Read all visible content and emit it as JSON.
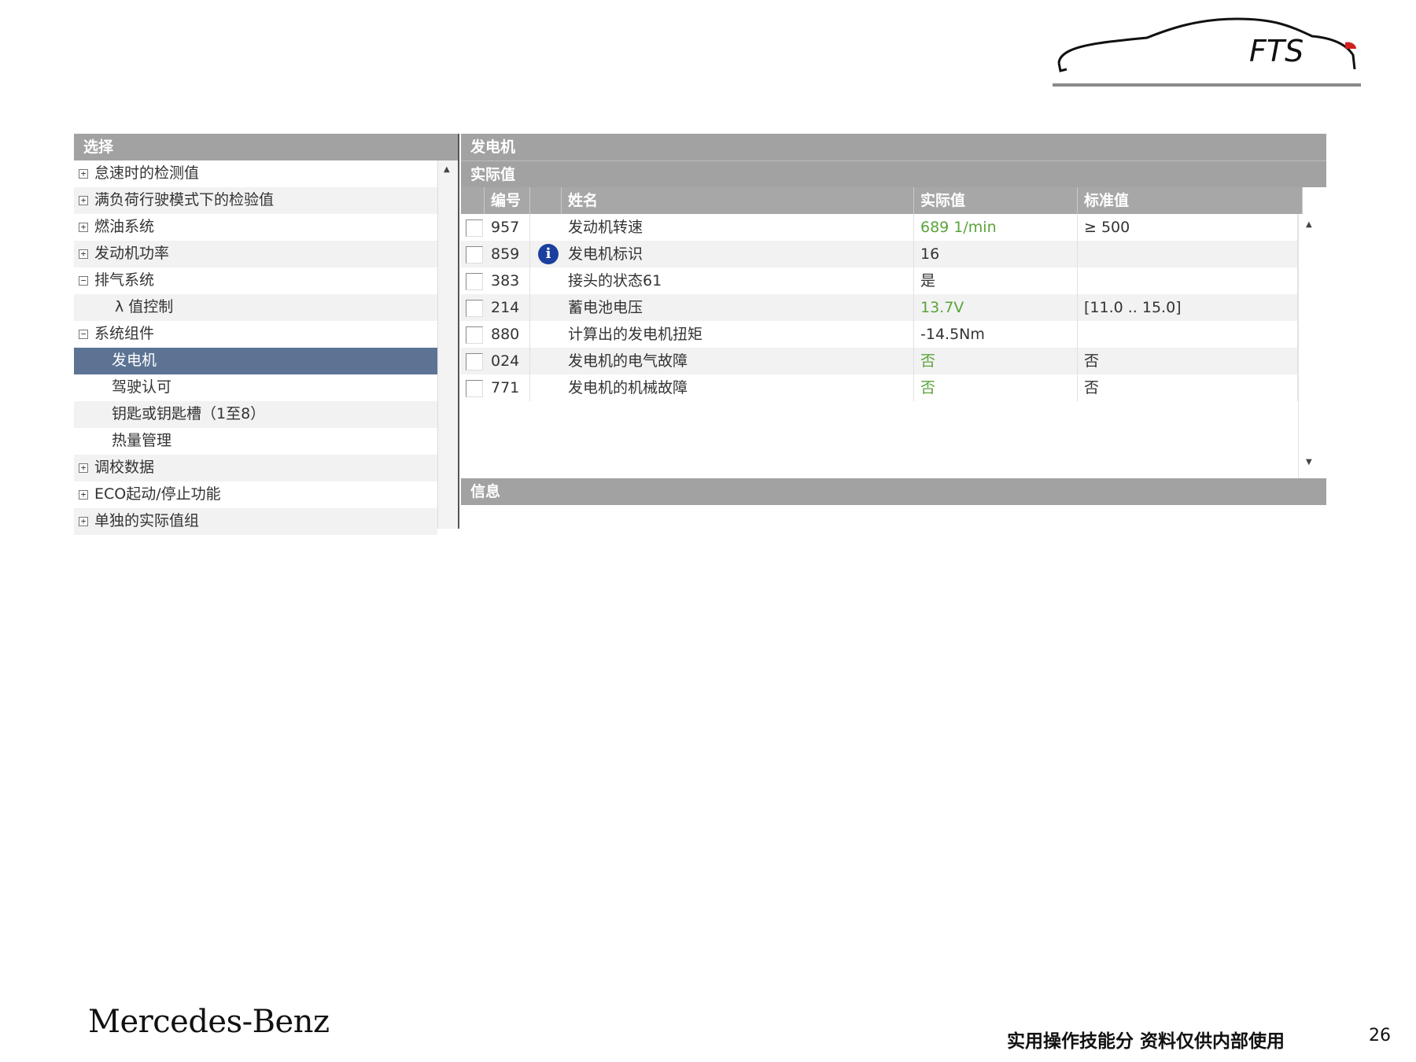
{
  "logo": {
    "text": "FTS"
  },
  "left_panel": {
    "header": "选择",
    "items": [
      {
        "label": "怠速时的检测值",
        "expander": "+",
        "indent": 0,
        "selected": false
      },
      {
        "label": "满负荷行驶模式下的检验值",
        "expander": "+",
        "indent": 0,
        "selected": false
      },
      {
        "label": "燃油系统",
        "expander": "+",
        "indent": 0,
        "selected": false
      },
      {
        "label": "发动机功率",
        "expander": "+",
        "indent": 0,
        "selected": false
      },
      {
        "label": "排气系统",
        "expander": "−",
        "indent": 0,
        "selected": false
      },
      {
        "label": "λ 值控制",
        "expander": "",
        "indent": 2,
        "selected": false
      },
      {
        "label": "系统组件",
        "expander": "−",
        "indent": 0,
        "selected": false
      },
      {
        "label": "发电机",
        "expander": "",
        "indent": 1,
        "selected": true
      },
      {
        "label": "驾驶认可",
        "expander": "",
        "indent": 1,
        "selected": false
      },
      {
        "label": "钥匙或钥匙槽（1至8）",
        "expander": "",
        "indent": 1,
        "selected": false
      },
      {
        "label": "热量管理",
        "expander": "",
        "indent": 1,
        "selected": false
      },
      {
        "label": "调校数据",
        "expander": "+",
        "indent": 0,
        "selected": false
      },
      {
        "label": "ECO起动/停止功能",
        "expander": "+",
        "indent": 0,
        "selected": false
      },
      {
        "label": "单独的实际值组",
        "expander": "+",
        "indent": 0,
        "selected": false
      }
    ]
  },
  "right_panel": {
    "title": "发电机",
    "subtitle": "实际值",
    "columns": {
      "id": "编号",
      "name": "姓名",
      "actual": "实际值",
      "standard": "标准值"
    },
    "rows": [
      {
        "id": "957",
        "info": false,
        "name": "发动机转速",
        "actual": "689 1/min",
        "actual_green": true,
        "standard": "≥ 500"
      },
      {
        "id": "859",
        "info": true,
        "name": "发电机标识",
        "actual": "16",
        "actual_green": false,
        "standard": ""
      },
      {
        "id": "383",
        "info": false,
        "name": "接头的状态61",
        "actual": "是",
        "actual_green": false,
        "standard": ""
      },
      {
        "id": "214",
        "info": false,
        "name": "蓄电池电压",
        "actual": "13.7V",
        "actual_green": true,
        "standard": "[11.0 .. 15.0]"
      },
      {
        "id": "880",
        "info": false,
        "name": "计算出的发电机扭矩",
        "actual": "-14.5Nm",
        "actual_green": false,
        "standard": ""
      },
      {
        "id": "024",
        "info": false,
        "name": "发电机的电气故障",
        "actual": "否",
        "actual_green": true,
        "standard": "否"
      },
      {
        "id": "771",
        "info": false,
        "name": "发电机的机械故障",
        "actual": "否",
        "actual_green": true,
        "standard": "否"
      }
    ],
    "info_header": "信息"
  },
  "footer": {
    "brand": "Mercedes-Benz",
    "note": "实用操作技能分 资料仅供内部使用",
    "page": "26"
  },
  "colors": {
    "header_gray": "#a2a2a2",
    "selection_blue": "#5c7394",
    "value_green": "#5aa43a",
    "info_blue": "#1a3f9e"
  },
  "icons": {
    "info": "info-icon",
    "expand": "plus-box-icon",
    "collapse": "minus-box-icon"
  }
}
